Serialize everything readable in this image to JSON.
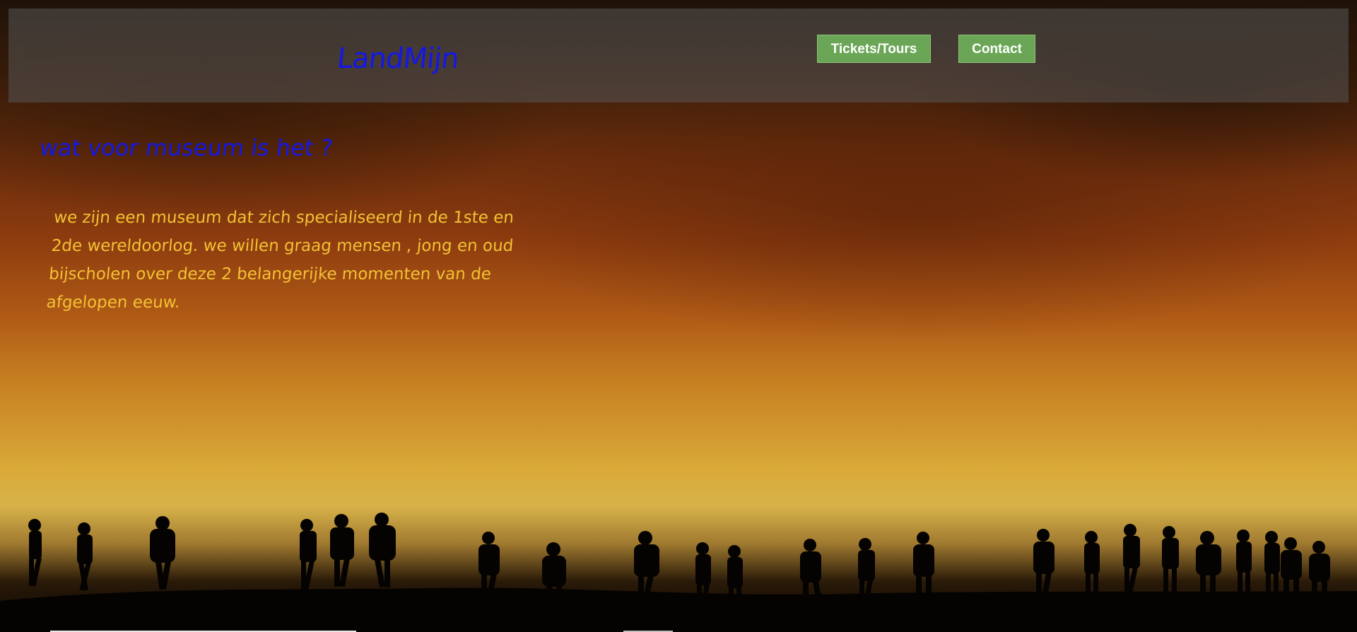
{
  "header": {
    "logo": "LandMijn",
    "nav": {
      "tickets_label": "Tickets/Tours",
      "contact_label": "Contact"
    }
  },
  "main": {
    "heading": "wat voor museum is het ?",
    "intro": "we zijn een museum dat zich specialiseerd in de 1ste en 2de wereldoorlog. we willen graag mensen , jong en oud bijscholen over deze 2 belangerijke momenten van de afgelopen eeuw."
  },
  "colors": {
    "logo": "#1418e6",
    "heading": "#1418e6",
    "intro_text": "#f2c233",
    "nav_button": "#6aa655"
  },
  "background": {
    "icon": "soldiers-silhouette-sunset"
  }
}
